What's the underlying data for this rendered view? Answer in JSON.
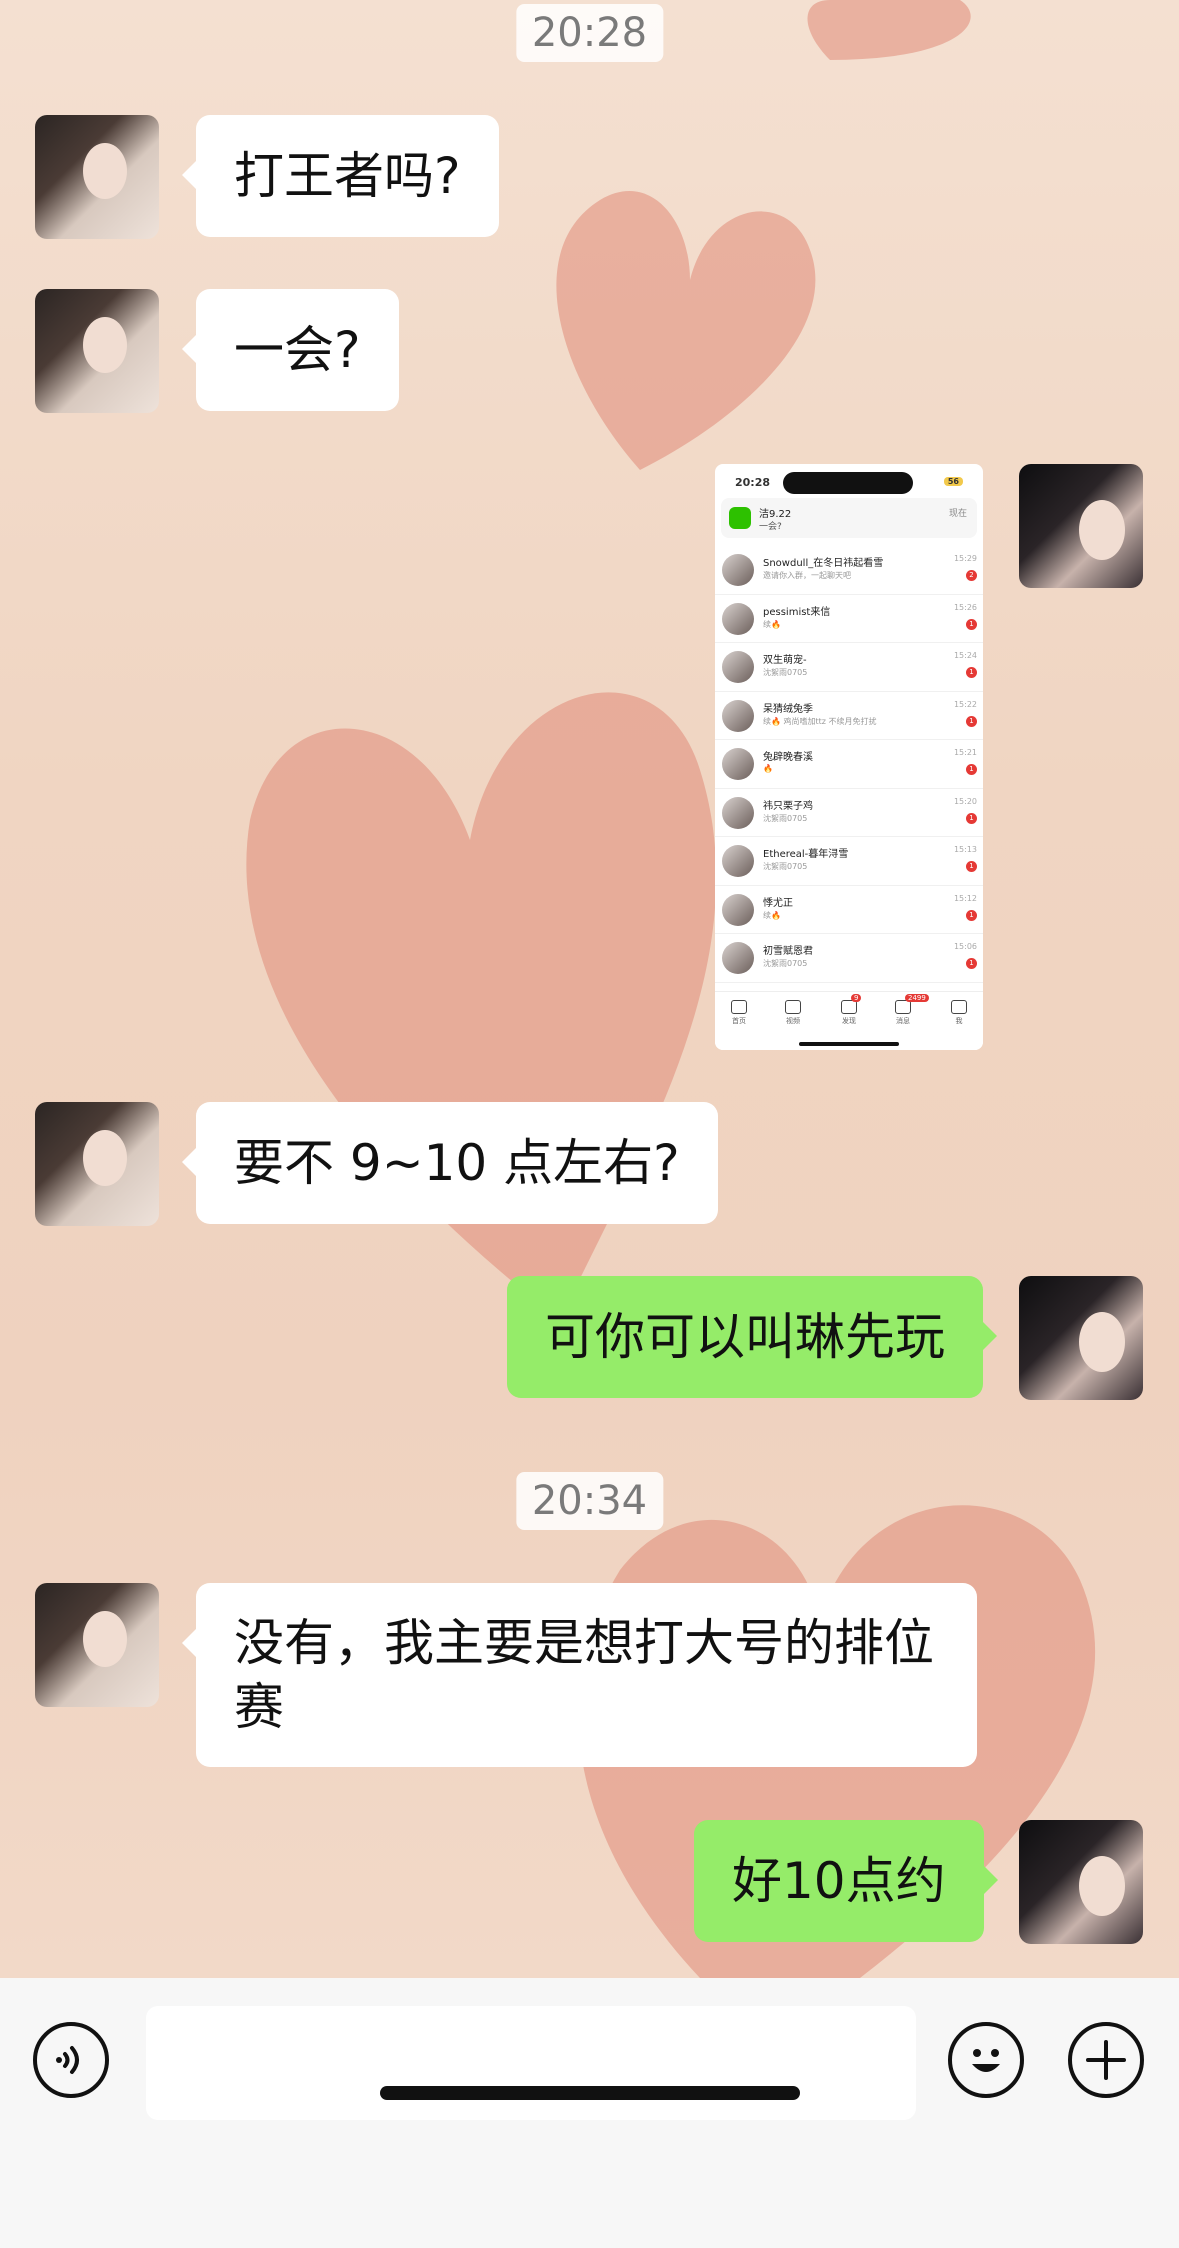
{
  "messages": [
    {
      "type": "timestamp",
      "text": "20:28"
    },
    {
      "type": "text",
      "side": "left",
      "text": "打王者吗?"
    },
    {
      "type": "text",
      "side": "left",
      "text": "一会?"
    },
    {
      "type": "image",
      "side": "right"
    },
    {
      "type": "text",
      "side": "left",
      "text": "要不 9~10 点左右?"
    },
    {
      "type": "text",
      "side": "right",
      "text": "可你可以叫琳先玩"
    },
    {
      "type": "timestamp",
      "text": "20:34"
    },
    {
      "type": "text",
      "side": "left",
      "text": "没有，我主要是想打大号的排位赛"
    },
    {
      "type": "text",
      "side": "right",
      "text": "好10点约"
    }
  ],
  "screenshot": {
    "status_time": "20:28",
    "battery": "56",
    "notification": {
      "title": "洁9.22",
      "body": "一会?",
      "time": "现在"
    },
    "rows": [
      {
        "name": "Snowdull_在冬日祎起看雪",
        "sub": "邀请你入群，一起聊天吧",
        "time": "15:29",
        "badge": "2"
      },
      {
        "name": "pessimist来信",
        "sub": "续🔥",
        "time": "15:26",
        "badge": "1"
      },
      {
        "name": "双生萌宠-",
        "sub": "沈絮雨0705",
        "time": "15:24",
        "badge": "1"
      },
      {
        "name": "呆猜绒兔季",
        "sub": "续🔥 鸡尚嗜加ttz 不续月免打扰",
        "time": "15:22",
        "badge": "1"
      },
      {
        "name": "兔辟晚春溪",
        "sub": "🔥",
        "time": "15:21",
        "badge": "1"
      },
      {
        "name": "祎只栗子鸡",
        "sub": "沈絮雨0705",
        "time": "15:20",
        "badge": "1"
      },
      {
        "name": "Ethereal-暮年浔雪",
        "sub": "沈絮雨0705",
        "time": "15:13",
        "badge": "1"
      },
      {
        "name": "悸尤正",
        "sub": "续🔥",
        "time": "15:12",
        "badge": "1"
      },
      {
        "name": "初雪赋恩君",
        "sub": "沈絮雨0705",
        "time": "15:06",
        "badge": "1"
      }
    ],
    "tabs": [
      {
        "label": "首页",
        "badge": ""
      },
      {
        "label": "视频",
        "badge": ""
      },
      {
        "label": "发现",
        "badge": "9"
      },
      {
        "label": "消息",
        "badge": "2499"
      },
      {
        "label": "我",
        "badge": ""
      }
    ]
  },
  "input": {
    "placeholder": ""
  },
  "colors": {
    "self_bubble": "#95ec69",
    "other_bubble": "#ffffff",
    "background": "#f0d5c2"
  }
}
